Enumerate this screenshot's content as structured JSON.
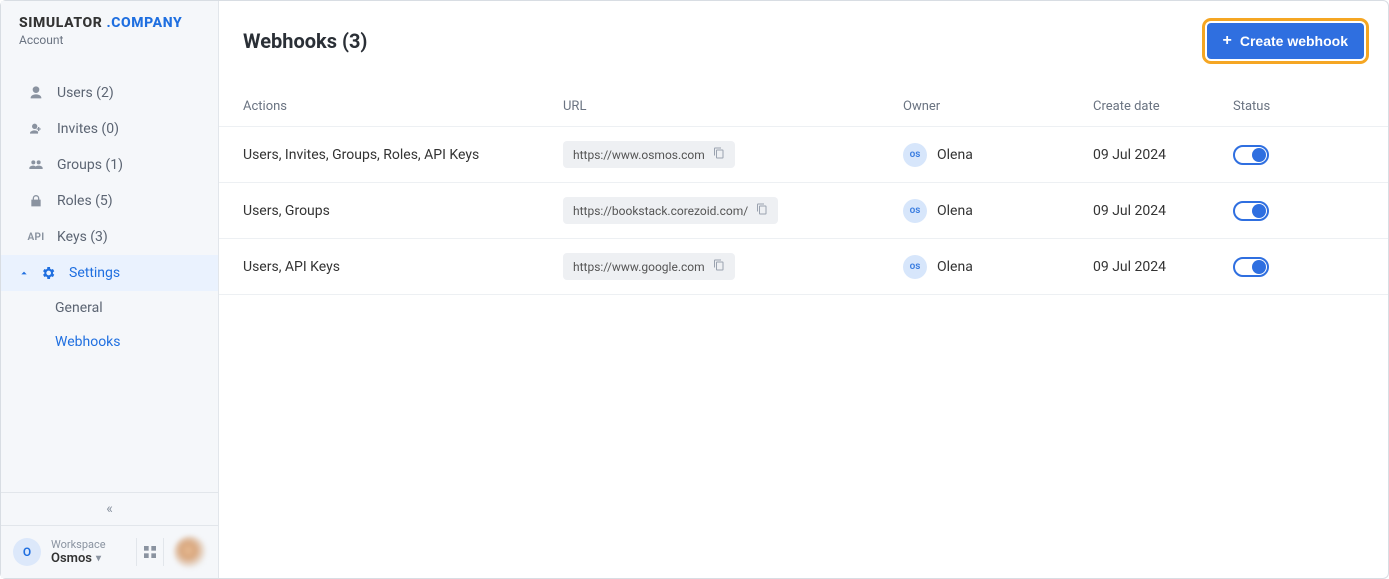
{
  "brand": {
    "title1": "SIMULATOR",
    "title2": ".COMPANY",
    "subtitle": "Account"
  },
  "nav": {
    "users": {
      "label": "Users (2)"
    },
    "invites": {
      "label": "Invites (0)"
    },
    "groups": {
      "label": "Groups (1)"
    },
    "roles": {
      "label": "Roles (5)"
    },
    "keys": {
      "label": "Keys (3)",
      "prefix": "API"
    },
    "settings": {
      "label": "Settings"
    },
    "sub": {
      "general": "General",
      "webhooks": "Webhooks"
    }
  },
  "collapse_glyph": "«",
  "footer": {
    "avatar_letter": "O",
    "workspace_label": "Workspace",
    "workspace_name": "Osmos"
  },
  "header": {
    "title": "Webhooks (3)",
    "create_label": "Create webhook"
  },
  "columns": {
    "actions": "Actions",
    "url": "URL",
    "owner": "Owner",
    "date": "Create date",
    "status": "Status"
  },
  "rows": [
    {
      "actions": "Users, Invites, Groups, Roles, API Keys",
      "url": "https://www.osmos.com",
      "owner_badge": "os",
      "owner": "Olena",
      "date": "09 Jul 2024"
    },
    {
      "actions": "Users, Groups",
      "url": "https://bookstack.corezoid.com/",
      "owner_badge": "os",
      "owner": "Olena",
      "date": "09 Jul 2024"
    },
    {
      "actions": "Users, API Keys",
      "url": "https://www.google.com",
      "owner_badge": "os",
      "owner": "Olena",
      "date": "09 Jul 2024"
    }
  ]
}
